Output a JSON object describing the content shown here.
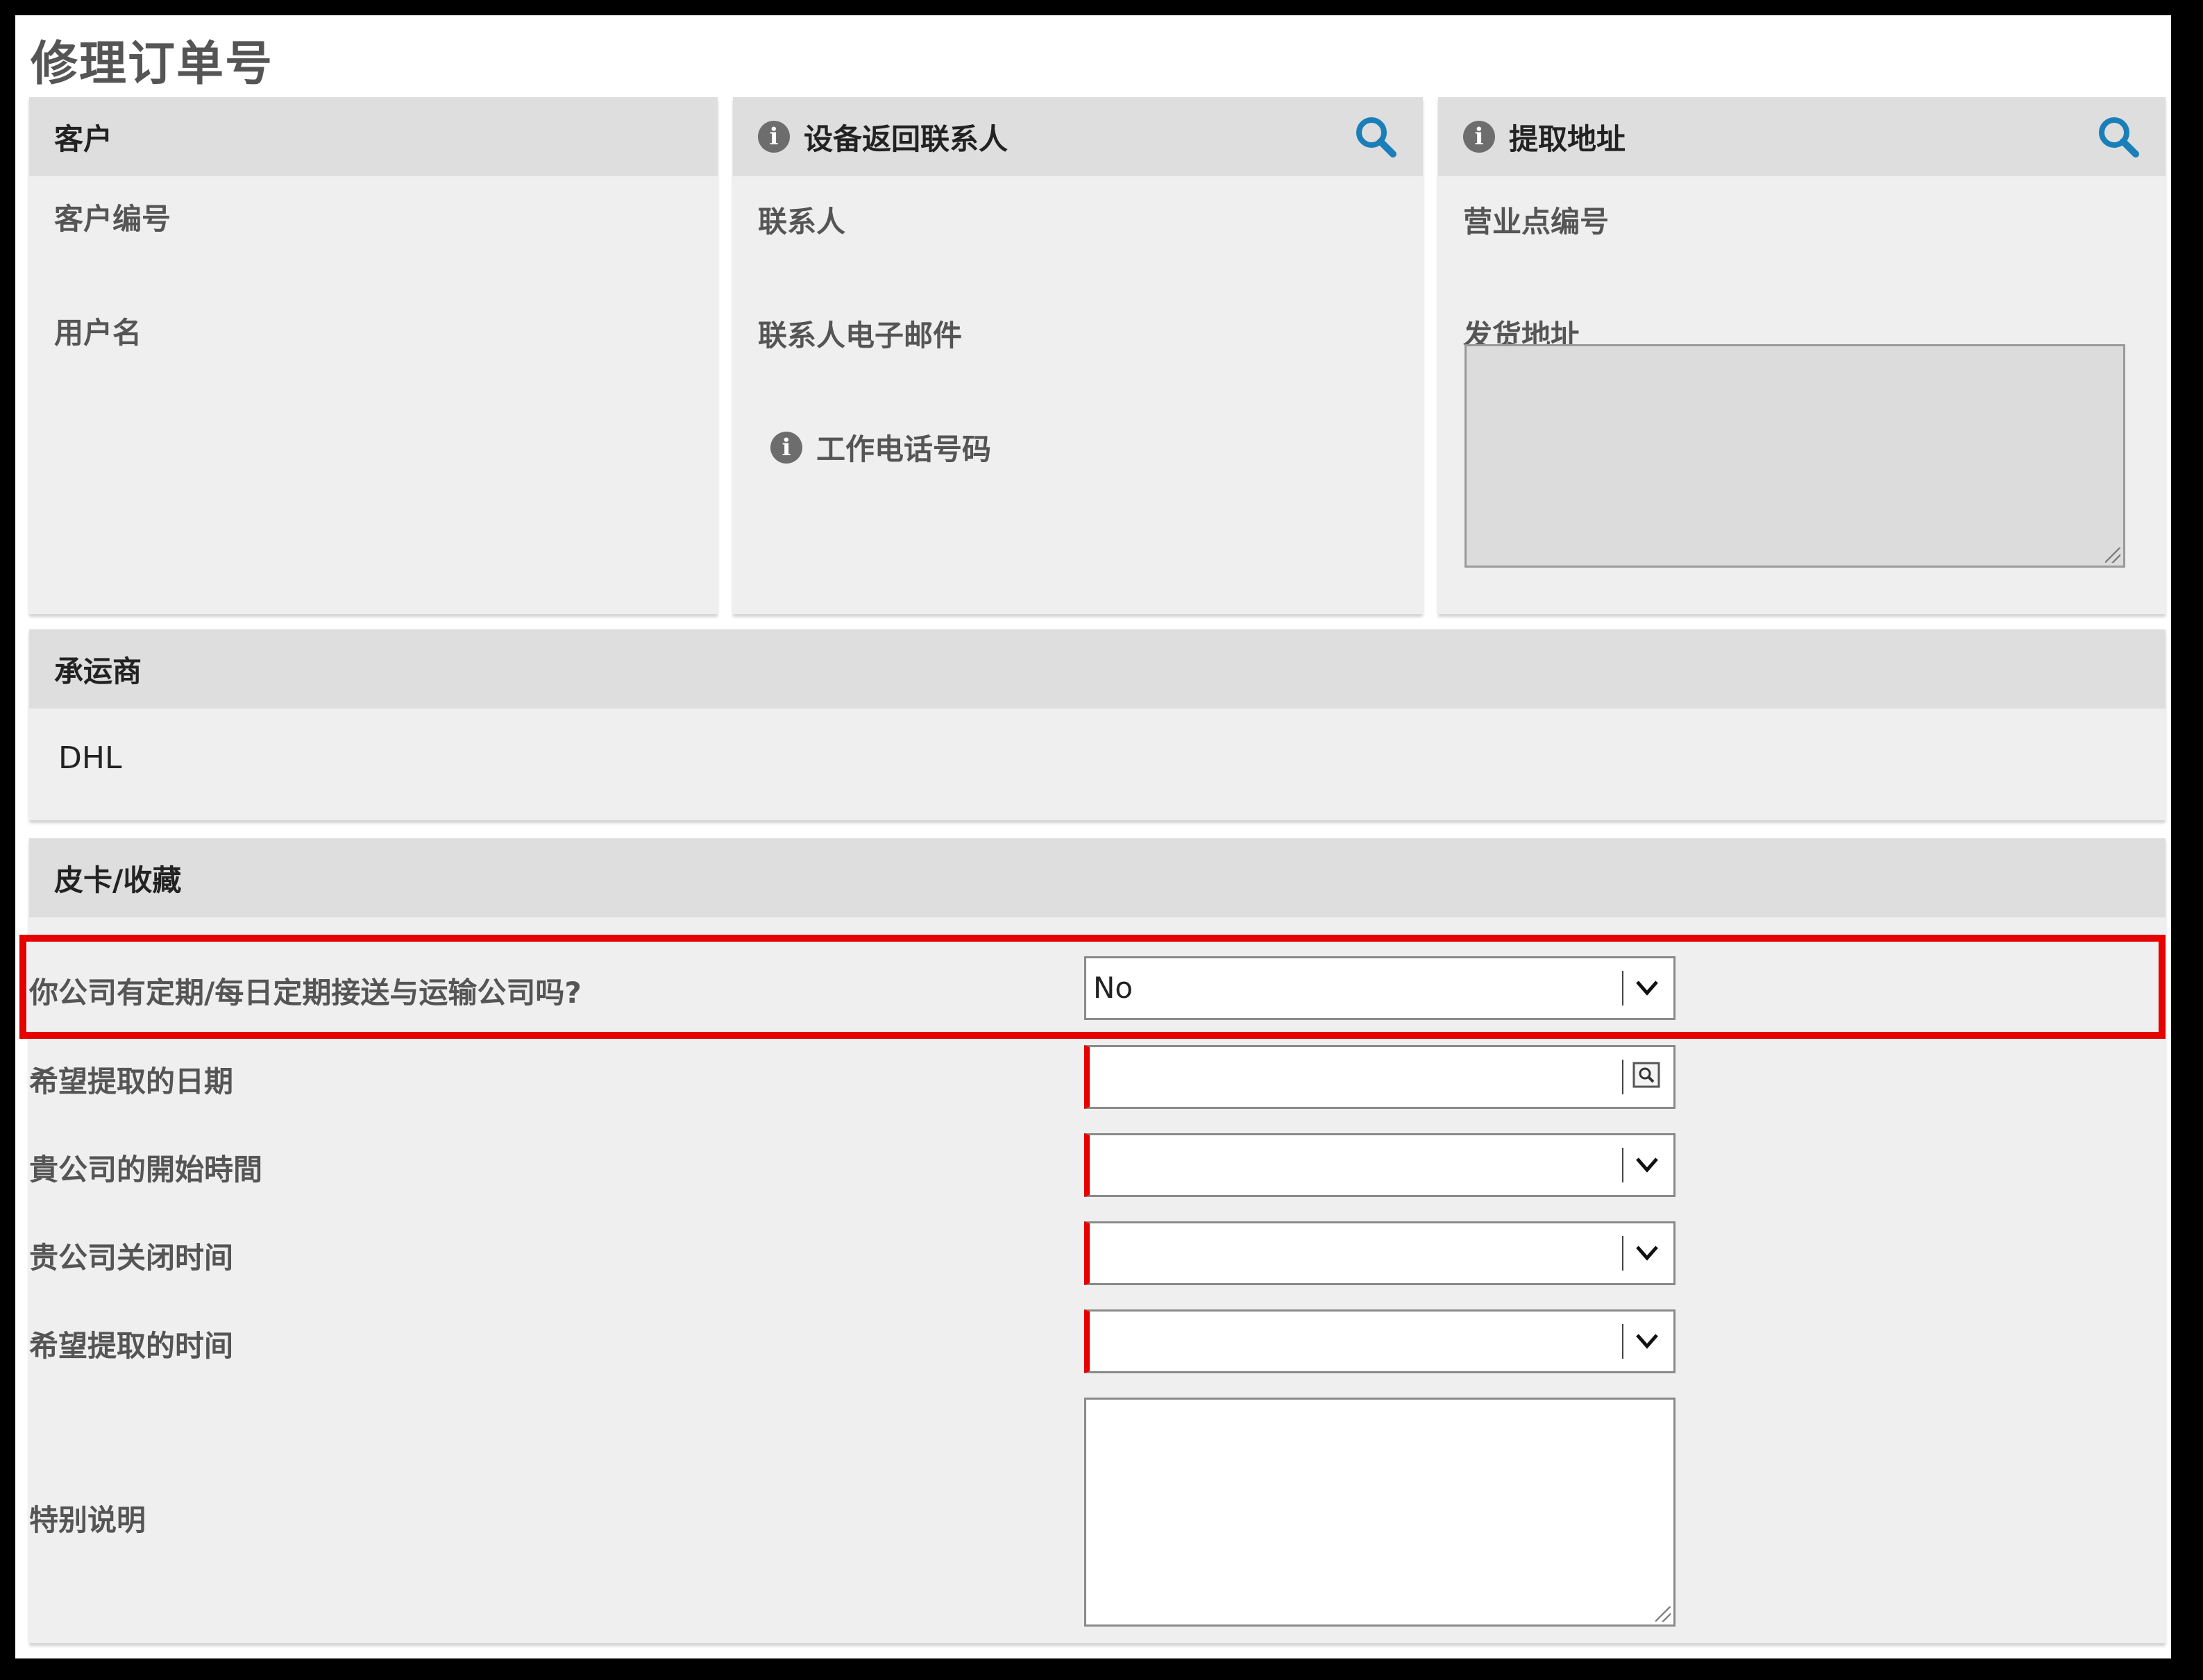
{
  "page": {
    "title": "修理订单号"
  },
  "customer": {
    "header": "客户",
    "fields": [
      "客户编号",
      "用户名"
    ]
  },
  "return_contact": {
    "header": "设备返回联系人",
    "fields": [
      "联系人",
      "联系人电子邮件",
      "工作电话号码"
    ]
  },
  "pickup_address": {
    "header": "提取地址",
    "fields": [
      "营业点编号",
      "发货地址"
    ]
  },
  "carrier": {
    "header": "承运商",
    "value": "DHL"
  },
  "pickup": {
    "header": "皮卡/收藏",
    "rows": [
      {
        "label": "你公司有定期/每日定期接送与运输公司吗?",
        "value": "No"
      },
      {
        "label": "希望提取的日期",
        "value": ""
      },
      {
        "label": "貴公司的開始時間",
        "value": ""
      },
      {
        "label": "贵公司关闭时间",
        "value": ""
      },
      {
        "label": "希望提取的时间",
        "value": ""
      },
      {
        "label": "特别说明",
        "value": ""
      }
    ]
  },
  "colors": {
    "accent_icon": "#1a7fb8",
    "required_marker": "#e60000",
    "highlight": "#e60000",
    "panel_bg": "#efefef",
    "panel_header_bg": "#dedede"
  },
  "icons": [
    "info-icon",
    "search-icon",
    "chevron-down-icon",
    "calendar-icon"
  ]
}
